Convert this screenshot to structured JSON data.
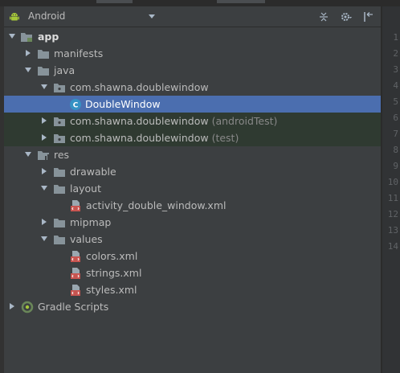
{
  "header": {
    "view_title": "Android",
    "icons": [
      "android-icon",
      "collapse-all-icon",
      "settings-gear-icon",
      "hide-panel-icon"
    ]
  },
  "tree": [
    {
      "label": "app",
      "icon": "module-folder-icon",
      "expanded": true
    },
    {
      "label": "manifests",
      "icon": "folder-icon",
      "expanded": false
    },
    {
      "label": "java",
      "icon": "folder-icon",
      "expanded": true
    },
    {
      "label": "com.shawna.doublewindow",
      "icon": "package-icon",
      "expanded": true
    },
    {
      "label": "DoubleWindow",
      "icon": "class-icon",
      "selected": true
    },
    {
      "label": "com.shawna.doublewindow",
      "suffix": "(androidTest)",
      "icon": "package-icon",
      "expanded": false
    },
    {
      "label": "com.shawna.doublewindow",
      "suffix": "(test)",
      "icon": "package-icon",
      "expanded": false
    },
    {
      "label": "res",
      "icon": "res-folder-icon",
      "expanded": true
    },
    {
      "label": "drawable",
      "icon": "folder-icon",
      "expanded": false
    },
    {
      "label": "layout",
      "icon": "folder-icon",
      "expanded": true
    },
    {
      "label": "activity_double_window.xml",
      "icon": "xml-file-icon"
    },
    {
      "label": "mipmap",
      "icon": "folder-icon",
      "expanded": false
    },
    {
      "label": "values",
      "icon": "folder-icon",
      "expanded": true
    },
    {
      "label": "colors.xml",
      "icon": "xml-file-icon"
    },
    {
      "label": "strings.xml",
      "icon": "xml-file-icon"
    },
    {
      "label": "styles.xml",
      "icon": "xml-file-icon"
    },
    {
      "label": "Gradle Scripts",
      "icon": "gradle-icon",
      "expanded": false
    }
  ],
  "gutter": {
    "line_numbers": [
      "1",
      "2",
      "3",
      "4",
      "5",
      "6",
      "7",
      "8",
      "9",
      "10",
      "11",
      "12",
      "13",
      "14"
    ]
  },
  "colors": {
    "panel_bg": "#3c3f41",
    "selection": "#4b6eaf",
    "test_row_bg": "#2f3a31",
    "folder": "#87939a",
    "class_circle": "#3592c4",
    "xml_icon": "#c75450"
  }
}
